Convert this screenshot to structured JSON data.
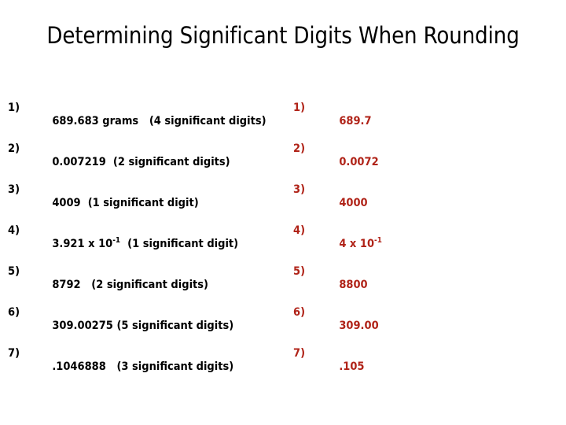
{
  "slide": {
    "title": "Determining Significant Digits When Rounding",
    "text_color": "#000000",
    "answer_color": "#B02318",
    "background": "#FFFFFF"
  },
  "problems": [
    {
      "marker": "1)",
      "value": "689.683 grams",
      "spacer": "   ",
      "note": "(4 significant digits)",
      "sup": null,
      "tail": null
    },
    {
      "marker": "2)",
      "value": "0.007219",
      "spacer": "  ",
      "note": "(2 significant digits)",
      "sup": null,
      "tail": null
    },
    {
      "marker": "3)",
      "value": "4009",
      "spacer": "  ",
      "note": "(1 significant digit)",
      "sup": null,
      "tail": null
    },
    {
      "marker": "4)",
      "value": "3.921 x 10",
      "spacer": "  ",
      "note": "(1 significant digit)",
      "sup": "-1",
      "tail": ""
    },
    {
      "marker": "5)",
      "value": "8792",
      "spacer": "   ",
      "note": "(2 significant digits)",
      "sup": null,
      "tail": null
    },
    {
      "marker": "6)",
      "value": "309.00275",
      "spacer": " ",
      "note": "(5 significant digits)",
      "sup": null,
      "tail": null
    },
    {
      "marker": "7)",
      "value": ".1046888",
      "spacer": "   ",
      "note": "(3 significant digits)",
      "sup": null,
      "tail": null
    }
  ],
  "answers": [
    {
      "marker": "1)",
      "value": "689.7",
      "sup": null,
      "tail": null
    },
    {
      "marker": "2)",
      "value": "0.0072",
      "sup": null,
      "tail": null
    },
    {
      "marker": "3)",
      "value": "4000",
      "sup": null,
      "tail": null
    },
    {
      "marker": "4)",
      "value": "4 x 10",
      "sup": "-1",
      "tail": ""
    },
    {
      "marker": "5)",
      "value": "8800",
      "sup": null,
      "tail": null
    },
    {
      "marker": "6)",
      "value": "309.00",
      "sup": null,
      "tail": null
    },
    {
      "marker": "7)",
      "value": ".105",
      "sup": null,
      "tail": null
    }
  ]
}
